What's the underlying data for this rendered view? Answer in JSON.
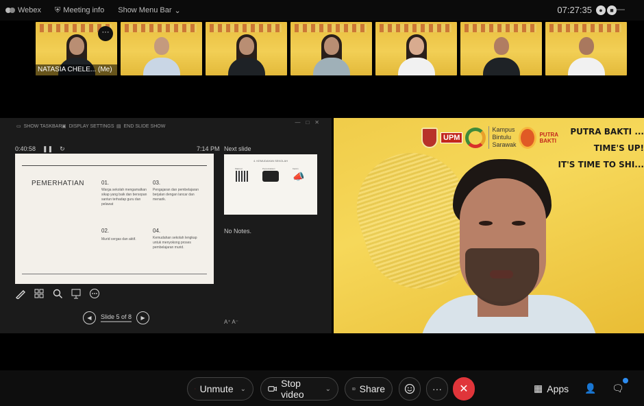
{
  "topbar": {
    "app_name": "Webex",
    "meeting_info": "Meeting info",
    "show_menu_bar": "Show Menu Bar",
    "time": "07:27:35"
  },
  "participants": [
    {
      "name": "NATASIA CHELE... (Me)",
      "more": "···"
    },
    {
      "name": ""
    },
    {
      "name": ""
    },
    {
      "name": ""
    },
    {
      "name": ""
    },
    {
      "name": ""
    },
    {
      "name": ""
    }
  ],
  "presenter": {
    "toolbar": [
      "SHOW TASKBAR",
      "DISPLAY SETTINGS",
      "END SLIDE SHOW"
    ],
    "elapsed": "0:40:58",
    "clock": "7:14 PM",
    "next_slide_label": "Next slide",
    "notes": "No Notes.",
    "slide_position": "Slide 5 of 8",
    "zoom": "A⁺ A⁻",
    "slide": {
      "title": "PEMERHATIAN",
      "items": [
        {
          "num": "01.",
          "text": "Warga sekolah mengamalkan sikap yang baik dan bersopan santun terhadap guru dan pelawat"
        },
        {
          "num": "02.",
          "text": "Murid cergas dan aktif."
        },
        {
          "num": "03.",
          "text": "Pengajaran dan pembelajaran berjalan dengan lancar dan menarik."
        },
        {
          "num": "04.",
          "text": "Kemudahan sekolah lengkap untuk menyokong proses pembelajaran murid."
        }
      ]
    },
    "next_slide": {
      "title": "4. KEMUDAHAN SEKOLAH",
      "labels": [
        "Makmal",
        "Perpustakaan",
        "Kantin"
      ]
    }
  },
  "speaker": {
    "logo_upm": "UPM",
    "campus": [
      "Kampus",
      "Bintulu",
      "Sarawak"
    ],
    "putra_bakti": [
      "PUTRA",
      "BAKTI"
    ],
    "slogan": [
      "PUTRA BAKTI ...",
      "TIME'S UP!",
      "IT'S TIME TO SHI..."
    ]
  },
  "controls": {
    "unmute": "Unmute",
    "stop_video": "Stop video",
    "share": "Share",
    "apps": "Apps"
  },
  "colors": {
    "end_call": "#e0353a",
    "background_yellow": "#f2cf4f",
    "notification_dot": "#2d8cf0"
  }
}
